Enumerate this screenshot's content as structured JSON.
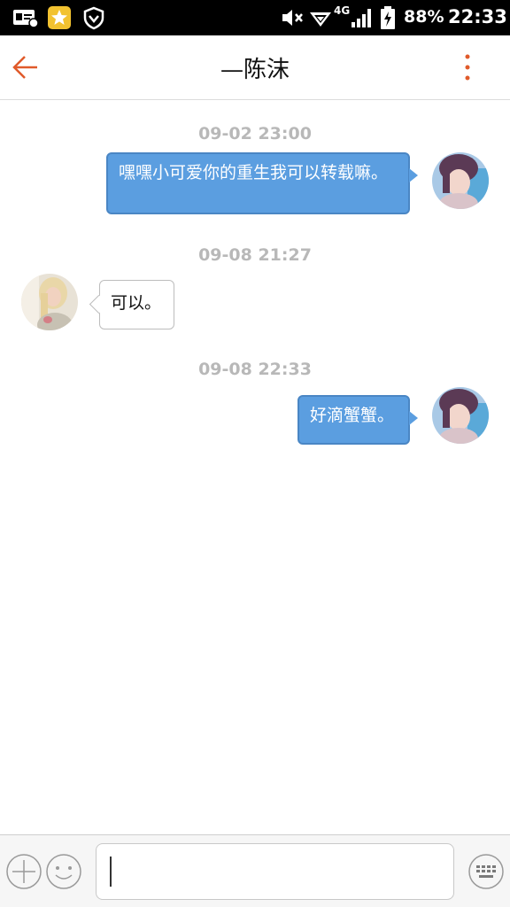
{
  "status_bar": {
    "battery": "88%",
    "time": "22:33",
    "network": "4G",
    "icons": [
      "id-card-icon",
      "star-app-icon",
      "shield-icon",
      "mute-icon",
      "wifi-icon",
      "signal-icon",
      "battery-icon"
    ]
  },
  "header": {
    "title": "—陈沫",
    "back_icon": "back-arrow-icon",
    "more_icon": "more-vertical-icon"
  },
  "messages": [
    {
      "timestamp": "09-02 23:00",
      "direction": "outgoing",
      "text": "嘿嘿小可爱你的重生我可以转载嘛。"
    },
    {
      "timestamp": "09-08 21:27",
      "direction": "incoming",
      "text": "可以。"
    },
    {
      "timestamp": "09-08 22:33",
      "direction": "outgoing",
      "text": "好滴蟹蟹。"
    }
  ],
  "input_bar": {
    "add_icon": "plus-icon",
    "emoji_icon": "emoji-icon",
    "keyboard_icon": "keyboard-icon",
    "value": ""
  },
  "colors": {
    "accent": "#e05a2a",
    "outgoing_bubble": "#5b9ee0",
    "timestamp": "#b8b8b8"
  }
}
